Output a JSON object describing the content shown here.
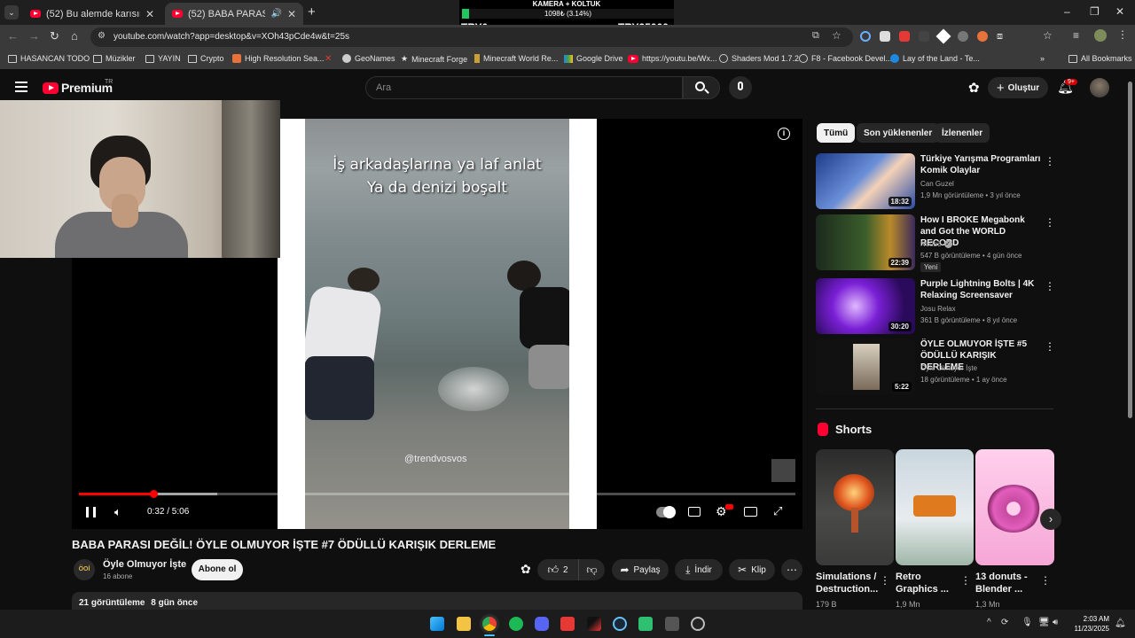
{
  "browser": {
    "tabs": [
      {
        "label": "(52) Bu alemde karısının lafıyla,"
      },
      {
        "label": "(52) BABA PARASI DEĞİL! Ö"
      }
    ],
    "url": "youtube.com/watch?app=desktop&v=XOh43pCde4w&t=25s",
    "bookmarks": [
      "HASANCAN TODO",
      "Müzikler",
      "YAYIN",
      "Crypto",
      "High Resolution Sea...",
      "GeoNames",
      "Minecraft Forge",
      "Minecraft World Re...",
      "Google Drive",
      "https://youtu.be/Wx...",
      "Shaders Mod 1.7.2",
      "F8 - Facebook Devel...",
      "Lay of the Land - Te..."
    ],
    "all_bookmarks": "All Bookmarks"
  },
  "stream_overlay": {
    "label": "KAMERA + KOLTUK",
    "progress_text": "1098₺ (3.14%)",
    "progress_fraction": 0.0314,
    "left_value": "TRY0",
    "right_value": "TRY35000"
  },
  "youtube_header": {
    "logo_text": "Premium",
    "logo_region": "TR",
    "search_placeholder": "Ara",
    "create_label": "Oluştur",
    "notif_badge": "9+"
  },
  "video": {
    "caption_line1": "İş arkadaşlarına ya laf anlat",
    "caption_line2": "Ya da denizi boşalt",
    "watermark": "@trendvosvos",
    "time": "0:32 / 5:06",
    "played_fraction": 0.104,
    "buffered_fraction": 0.193,
    "title": "BABA PARASI DEĞİL! ÖYLE OLMUYOR İŞTE #7 ÖDÜLLÜ KARIŞIK DERLEME"
  },
  "channel": {
    "name": "Öyle Olmuyor İşte",
    "subs": "16 abone",
    "subscribe_label": "Abone ol",
    "avatar_text": "ÖOİ"
  },
  "actions": {
    "like_count": "2",
    "share_label": "Paylaş",
    "download_label": "İndir",
    "clip_label": "Klip"
  },
  "description": {
    "views": "21 görüntüleme",
    "age": "8 gün önce"
  },
  "sidebar": {
    "chips": [
      "Tümü",
      "Son yüklenenler",
      "İzlenenler"
    ],
    "recommendations": [
      {
        "title": "Türkiye Yarışma Programları Komik Olaylar",
        "channel": "Can Guzel",
        "meta": "1,9 Mn görüntüleme • 3 yıl önce",
        "duration": "18:32",
        "badge": ""
      },
      {
        "title": "How I BROKE Megabonk and Got the WORLD RECORD",
        "channel": "No0b3",
        "meta": "547 B görüntüleme • 4 gün önce",
        "duration": "22:39",
        "badge": "Yeni"
      },
      {
        "title": "Purple Lightning Bolts | 4K Relaxing Screensaver",
        "channel": "Josu Relax",
        "meta": "361 B görüntüleme • 8 yıl önce",
        "duration": "30:20",
        "badge": ""
      },
      {
        "title": "ÖYLE OLMUYOR İŞTE #5 ÖDÜLLÜ KARIŞIK DERLEME",
        "channel": "Öyle Olmuyor İşte",
        "meta": "18 görüntüleme • 1 ay önce",
        "duration": "5:22",
        "badge": ""
      }
    ],
    "shorts_heading": "Shorts",
    "shorts": [
      {
        "title": "Simulations / Destruction...",
        "views": "179 B"
      },
      {
        "title": "Retro Graphics ...",
        "views": "1,9 Mn"
      },
      {
        "title": "13 donuts - Blender ...",
        "views": "1,3 Mn"
      }
    ]
  },
  "taskbar": {
    "time": "2:03 AM",
    "date": "11/23/2025"
  }
}
